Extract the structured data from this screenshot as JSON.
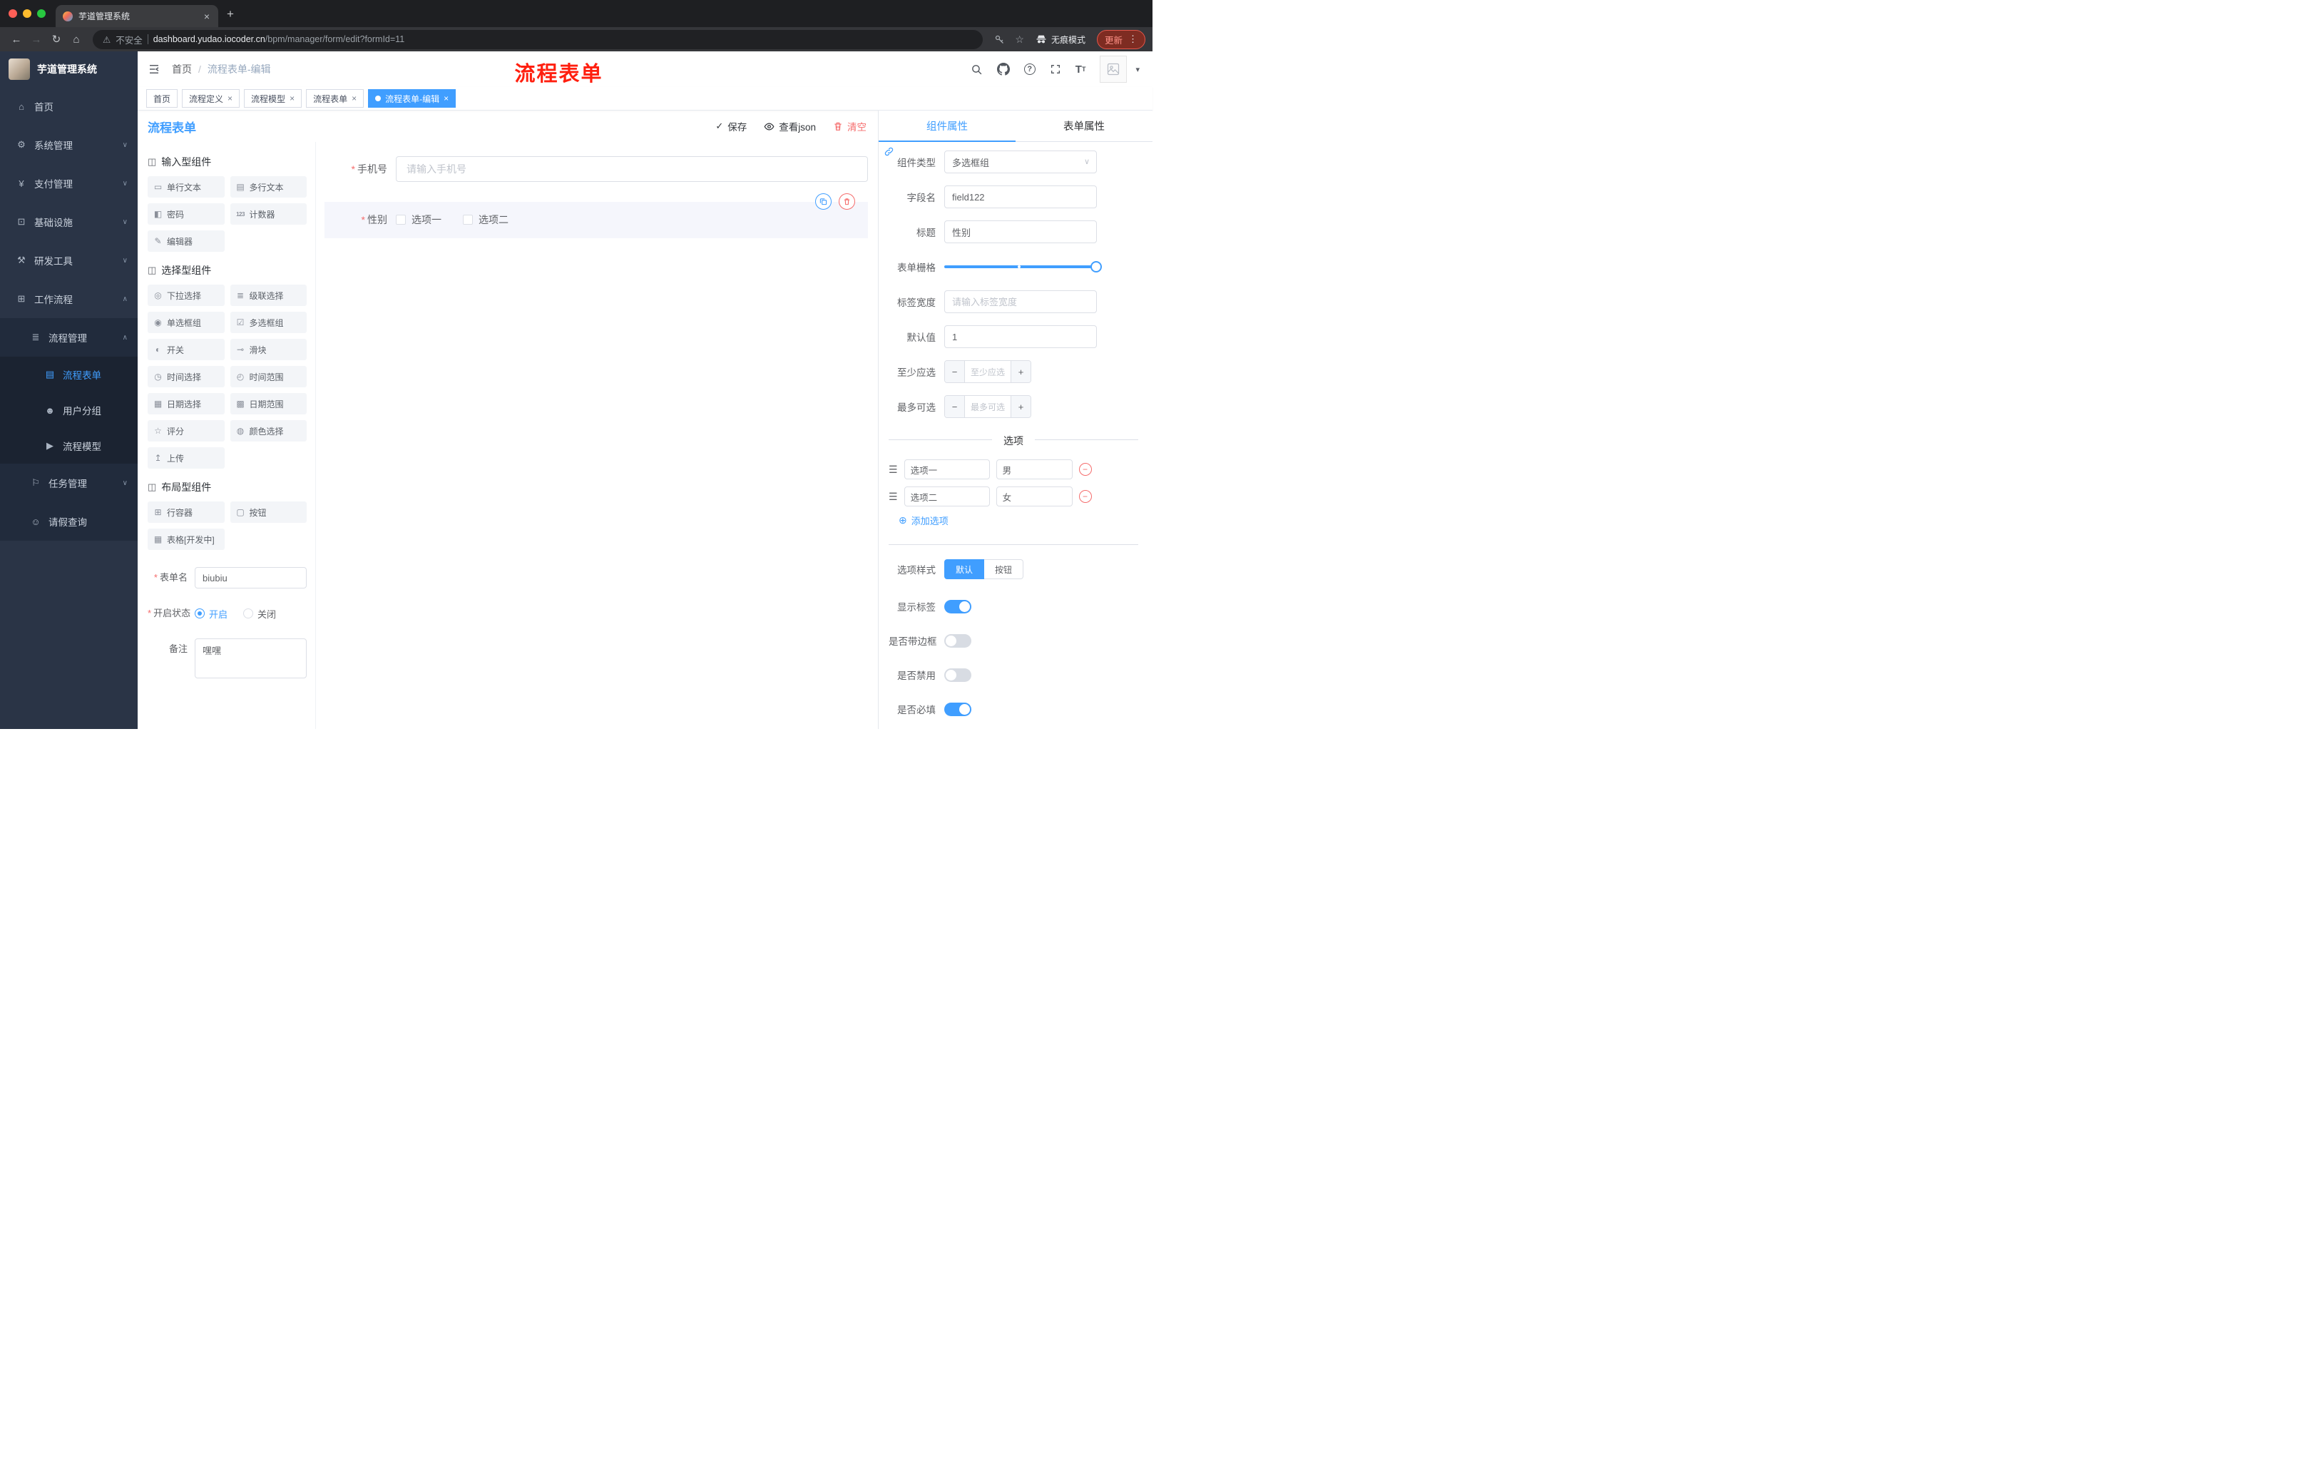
{
  "icons": {
    "close": "×",
    "plus": "+",
    "caret_down": "▾",
    "check": "✓",
    "star": "☆",
    "warning": "⚠",
    "back": "←",
    "forward": "→",
    "reload": "↻",
    "home": "⌂",
    "dots": "⋮",
    "minus": "−",
    "plus_math": "+",
    "add_circle": "⊕",
    "drag": "☰",
    "select_caret": "∨"
  },
  "browser": {
    "tab_title": "芋道管理系统",
    "security_label": "不安全",
    "url_domain": "dashboard.yudao.iocoder.cn",
    "url_path": "/bpm/manager/form/edit?formId=11",
    "incognito_label": "无痕模式",
    "update_label": "更新"
  },
  "sidebar": {
    "logo_title": "芋道管理系统",
    "items": [
      {
        "label": "首页",
        "glyph": "⌂"
      },
      {
        "label": "系统管理",
        "glyph": "⚙",
        "chevron": "∨"
      },
      {
        "label": "支付管理",
        "glyph": "¥",
        "chevron": "∨"
      },
      {
        "label": "基础设施",
        "glyph": "⊡",
        "chevron": "∨"
      },
      {
        "label": "研发工具",
        "glyph": "⚒",
        "chevron": "∨"
      },
      {
        "label": "工作流程",
        "glyph": "⊞",
        "chevron": "∧"
      },
      {
        "label": "流程管理",
        "glyph": "≣",
        "chevron": "∧"
      },
      {
        "label": "流程表单",
        "glyph": "▤",
        "active": true
      },
      {
        "label": "用户分组",
        "glyph": "☻"
      },
      {
        "label": "流程模型",
        "glyph": "▶"
      },
      {
        "label": "任务管理",
        "glyph": "⚐",
        "chevron": "∨"
      },
      {
        "label": "请假查询",
        "glyph": "☺"
      }
    ]
  },
  "header": {
    "breadcrumb": {
      "home": "首页",
      "separator": "/",
      "current": "流程表单-编辑"
    },
    "annotation": "流程表单"
  },
  "tags": [
    {
      "label": "首页"
    },
    {
      "label": "流程定义"
    },
    {
      "label": "流程模型"
    },
    {
      "label": "流程表单"
    },
    {
      "label": "流程表单-编辑",
      "active": true
    }
  ],
  "designer": {
    "title": "流程表单",
    "actions": {
      "save": "保存",
      "view_json": "查看json",
      "clear": "清空"
    },
    "palette": {
      "groups": [
        {
          "title": "输入型组件",
          "icon_glyph": "◫",
          "items": [
            {
              "label": "单行文本",
              "glyph": "▭"
            },
            {
              "label": "多行文本",
              "glyph": "▤"
            },
            {
              "label": "密码",
              "glyph": "◧"
            },
            {
              "label": "计数器",
              "glyph": "123"
            },
            {
              "label": "编辑器",
              "glyph": "✎"
            }
          ]
        },
        {
          "title": "选择型组件",
          "icon_glyph": "◫",
          "items": [
            {
              "label": "下拉选择",
              "glyph": "◎"
            },
            {
              "label": "级联选择",
              "glyph": "≣"
            },
            {
              "label": "单选框组",
              "glyph": "◉"
            },
            {
              "label": "多选框组",
              "glyph": "☑"
            },
            {
              "label": "开关",
              "glyph": "◐"
            },
            {
              "label": "滑块",
              "glyph": "⊸"
            },
            {
              "label": "时间选择",
              "glyph": "◷"
            },
            {
              "label": "时间范围",
              "glyph": "◴"
            },
            {
              "label": "日期选择",
              "glyph": "▦"
            },
            {
              "label": "日期范围",
              "glyph": "▩"
            },
            {
              "label": "评分",
              "glyph": "☆"
            },
            {
              "label": "颜色选择",
              "glyph": "◍"
            },
            {
              "label": "上传",
              "glyph": "↥"
            }
          ]
        },
        {
          "title": "布局型组件",
          "icon_glyph": "◫",
          "items": [
            {
              "label": "行容器",
              "glyph": "⊞"
            },
            {
              "label": "按钮",
              "glyph": "▢"
            },
            {
              "label": "表格[开发中]",
              "glyph": "▦"
            }
          ]
        }
      ]
    },
    "form_config": {
      "name_label": "表单名",
      "name_value": "biubiu",
      "status_label": "开启状态",
      "status_on": "开启",
      "status_off": "关闭",
      "remark_label": "备注",
      "remark_value": "嘿嘿"
    },
    "canvas": {
      "phone": {
        "label": "手机号",
        "placeholder": "请输入手机号"
      },
      "gender": {
        "label": "性别",
        "option1": "选项一",
        "option2": "选项二"
      }
    }
  },
  "properties": {
    "tab_component": "组件属性",
    "tab_form": "表单属性",
    "component_type": {
      "label": "组件类型",
      "value": "多选框组"
    },
    "field_name": {
      "label": "字段名",
      "value": "field122"
    },
    "title": {
      "label": "标题",
      "value": "性别"
    },
    "grid": {
      "label": "表单栅格"
    },
    "label_width": {
      "label": "标签宽度",
      "placeholder": "请输入标签宽度"
    },
    "default_value": {
      "label": "默认值",
      "value": "1"
    },
    "min_select": {
      "label": "至少应选",
      "placeholder": "至少应选"
    },
    "max_select": {
      "label": "最多可选",
      "placeholder": "最多可选"
    },
    "options_divider": "选项",
    "options": [
      {
        "label": "选项一",
        "value": "男"
      },
      {
        "label": "选项二",
        "value": "女"
      }
    ],
    "add_option": "添加选项",
    "option_style": {
      "label": "选项样式",
      "opt_default": "默认",
      "opt_button": "按钮"
    },
    "switches": [
      {
        "label": "显示标签",
        "on": true
      },
      {
        "label": "是否带边框",
        "on": false
      },
      {
        "label": "是否禁用",
        "on": false
      },
      {
        "label": "是否必填",
        "on": true
      }
    ]
  }
}
